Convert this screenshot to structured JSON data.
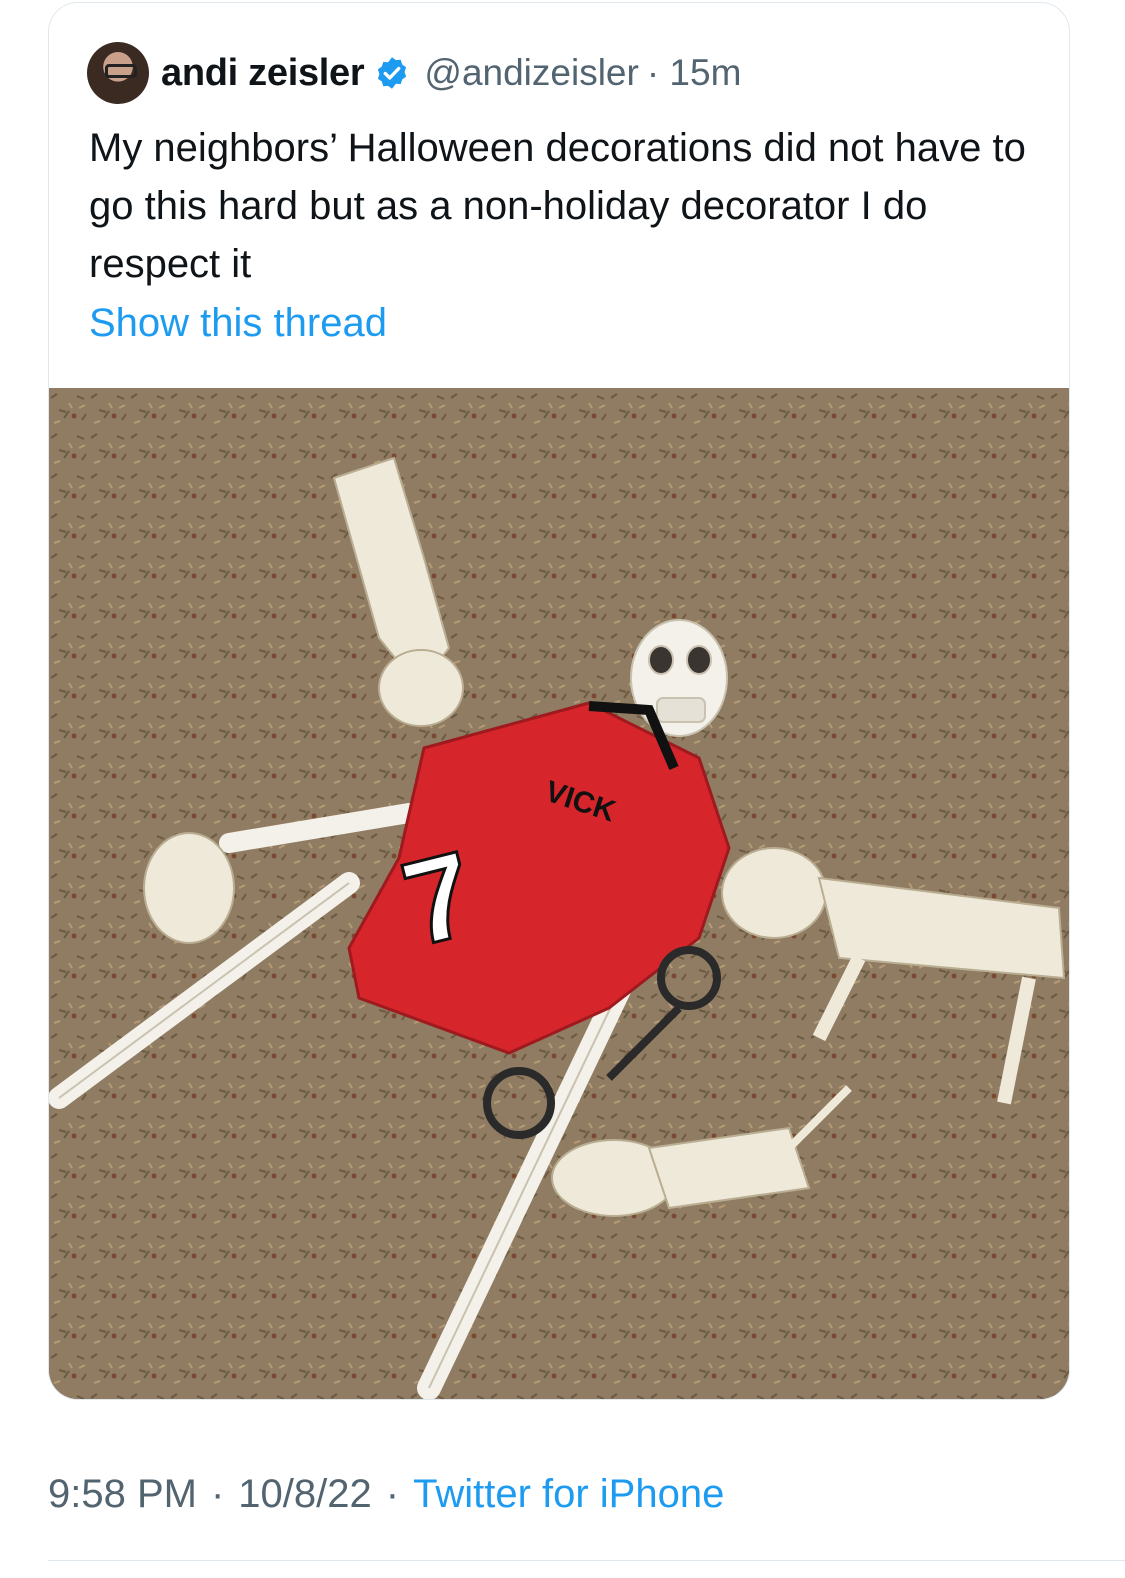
{
  "tweet": {
    "author": {
      "name": "andi zeisler",
      "handle": "@andizeisler",
      "verified_icon": "verified-badge-icon",
      "avatar_icon": "avatar"
    },
    "time_ago": "· 15m",
    "text": "My neighbors’ Halloween decorations did not have to go this hard but as a non-holiday decorator I do respect it",
    "show_thread": "Show this thread",
    "photo": {
      "jersey_name": "VICK",
      "jersey_number": "7"
    },
    "footer": {
      "time": "9:58 PM",
      "sep1": "·",
      "date": "10/8/22",
      "sep2": "·",
      "source": "Twitter for iPhone"
    }
  },
  "colors": {
    "link": "#1d9bf0",
    "muted": "#536471",
    "jersey": "#d7262b",
    "grass": "#8d7a60",
    "bone": "#efe9da"
  }
}
